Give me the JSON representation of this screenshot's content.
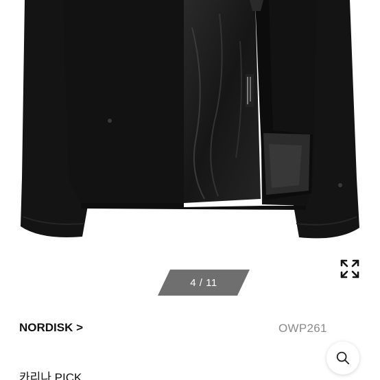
{
  "product": {
    "brand_label": "NORDISK >",
    "code": "OWP261",
    "name": "카리나 PICK"
  },
  "gallery": {
    "page_indicator": "4 / 11",
    "current_index": 4,
    "total_images": 11
  },
  "icons": {
    "expand": "expand-arrows-icon",
    "search": "magnifier-icon"
  },
  "colors": {
    "jacket": "#121212",
    "lining": "#1c1c1c",
    "indicator_bg": "#6f6f6f",
    "brand_text": "#111111",
    "code_text": "#8a8a8a"
  }
}
